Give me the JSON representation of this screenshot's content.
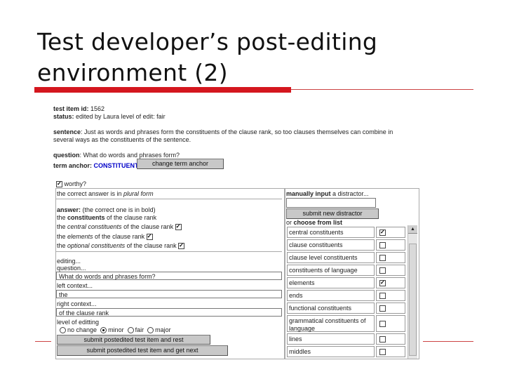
{
  "slide": {
    "title_line1": "Test developer’s post-editing",
    "title_line2": "environment (2)"
  },
  "item": {
    "id_label": "test item id:",
    "id_value": " 1562",
    "status_label": "status:",
    "status_value": " edited by Laura level of edit: fair",
    "sentence_label": "sentence",
    "sentence_line1": ": Just as words and phrases form the constituents of the clause rank, so too clauses themselves can combine in",
    "sentence_line2": "several ways as the constituents of the sentence.",
    "question_label": "question",
    "question_value": ": What do words and phrases form?",
    "term_anchor_label": "term anchor:",
    "term_anchor_value": "CONSTITUENT",
    "change_term_button": "change term anchor"
  },
  "left": {
    "worthy_label": "worthy?",
    "correct_in": "the correct answer is in ",
    "plural_form": "plural form",
    "answer_label": "answer:",
    "answer_note": " (the correct one is in bold)",
    "answers": [
      {
        "pre": "the ",
        "em": "constituents",
        "post": " of the clause rank",
        "style": "bold",
        "checked": false
      },
      {
        "pre": "the ",
        "em": "central constituents",
        "post": " of the clause rank",
        "style": "italic",
        "checked": true
      },
      {
        "pre": "the ",
        "em": "elements",
        "post": " of the clause rank",
        "style": "italic",
        "checked": true
      },
      {
        "pre": "the ",
        "em": "optional constituents",
        "post": " of the clause rank",
        "style": "italic",
        "checked": true
      }
    ],
    "editing_label": "editing...",
    "question_label": "question...",
    "question_value": "What do words and phrases form?",
    "left_context_label": "left context...",
    "left_context_value": "the",
    "right_context_label": "right context...",
    "right_context_value": "of the clause rank",
    "level_label": "level of editting",
    "levels": [
      "no change",
      "minor",
      "fair",
      "major"
    ],
    "level_selected": "minor",
    "submit_rest_button": "submit postedited test item and rest",
    "submit_next_button": "submit postedited test item and get next"
  },
  "right": {
    "manual_label": "manually input",
    "manual_suffix": " a distractor...",
    "manual_value": "",
    "submit_distractor_button": "submit new distractor",
    "or_label": "or ",
    "choose_label": "choose from list",
    "distractors": [
      {
        "name": "central constituents",
        "checked": true
      },
      {
        "name": "clause constituents",
        "checked": false
      },
      {
        "name": "clause level constituents",
        "checked": false
      },
      {
        "name": "constituents of language",
        "checked": false
      },
      {
        "name": "elements",
        "checked": true
      },
      {
        "name": "ends",
        "checked": false
      },
      {
        "name": "functional constituents",
        "checked": false
      },
      {
        "name": "grammatical constituents of language",
        "checked": false
      },
      {
        "name": "lines",
        "checked": false
      },
      {
        "name": "middles",
        "checked": false
      }
    ]
  },
  "icons": {
    "scroll_up": "up-arrow-icon",
    "checkbox": "checkbox-icon"
  },
  "colors": {
    "accent_bar": "#d4161e",
    "term_anchor": "#0000c8"
  }
}
